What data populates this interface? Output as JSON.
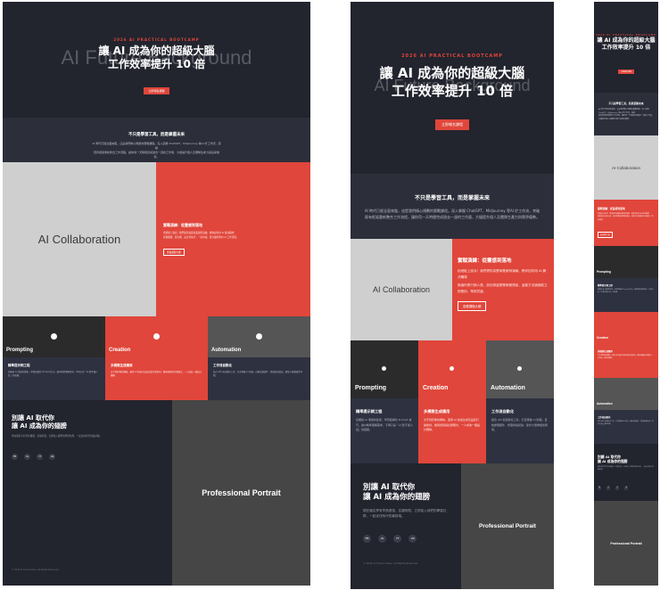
{
  "hero": {
    "eyebrow": "2026 AI PRACTICAL BOOTCAMP",
    "title_line1": "讓 AI 成為你的超級大腦",
    "title_line2": "工作效率提升 10 倍",
    "ghost_text": "AI Future Background",
    "cta_label": "立即報名課程"
  },
  "intro": {
    "title": "不只是學習工具，而是掌握未來",
    "text_line1": "AI 時代已經全面來臨，這是我們精心規劃的實戰課程。深入掌握 ChatGPT、Midjourney 等AI 於工作流，突破",
    "text_line2": "既有框架重新整合工作流程，讓你用一天時間完成過去一週的工作量，大幅提升個人及團隊生產力與競爭優勢。"
  },
  "collab": {
    "label": "AI Collaboration"
  },
  "practice": {
    "title": "實戰演練：從靈感到落地",
    "text_line1": "拒絕紙上談兵！我們提供真實商業案例演練，教你如何用 AI 解決職場",
    "text_line2": "真實難題，從企劃、設計到執行，一氣呵成，建立屬於你的 AI 工作流程。",
    "text_line3": "無論你是行銷人員、設計師還是專案管理者，這套方法論都能立即應用，帶來質變。",
    "button_label": "查看課程大綱"
  },
  "cards": [
    {
      "label": "Prompting",
      "title": "精準提示詞工程",
      "text": "掌握與 AI 溝通的藝術，學習結構化 Prompt 技巧，讓AI精準理解需求，不再只是「AI 聽不懂人話」的困擾。"
    },
    {
      "label": "Creation",
      "title": "多模態生成應用",
      "text": "文字到影像的轉換，運用 AI 快速生成高品質行銷素材，簡報視覺與社群圖文，一人成為一個設計團隊。"
    },
    {
      "label": "Automation",
      "title": "工作流自動化",
      "text": "結合 API 與自動化工具，打造專屬 AI 助理，自動處理郵件、整理會議紀錄，節省大量重複性時間。"
    }
  ],
  "future": {
    "title_line1": "別讓 AI 取代你",
    "title_line2": "讓 AI 成為你的翅膀",
    "text": "現在報名享有早鳥優惠，名額有限，立即加入我們的學習社群，一起走在時代的最前端。",
    "social": [
      "FB",
      "IG",
      "YT",
      "LN"
    ]
  },
  "portrait": {
    "label": "Professional Portrait"
  },
  "footer": {
    "text": "© 2026 AI Future Class. All Rights Reserved."
  }
}
